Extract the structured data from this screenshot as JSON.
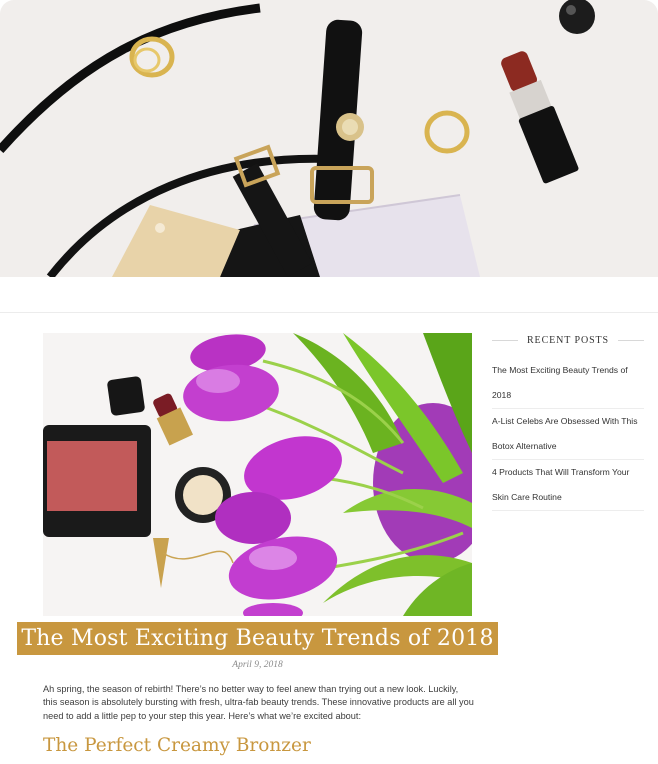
{
  "colors": {
    "accent": "#c8973f",
    "text": "#3d3d3d",
    "divider": "#ececec"
  },
  "sidebar": {
    "widget_title": "RECENT POSTS",
    "posts": [
      {
        "title": "The Most Exciting Beauty Trends of 2018"
      },
      {
        "title": "A-List Celebs Are Obsessed With This Botox Alternative"
      },
      {
        "title": "4 Products That Will Transform Your Skin Care Routine"
      }
    ]
  },
  "post": {
    "title": "The Most Exciting Beauty Trends of 2018",
    "date": "April 9, 2018",
    "excerpt": "Ah spring, the season of rebirth! There’s no better way to feel anew than trying out a new look. Luckily, this season is absolutely bursting with fresh, ultra-fab beauty trends. These innovative products are all you need to add a little pep to your step this year. Here’s what we’re excited about:",
    "subheading": "The Perfect Creamy Bronzer"
  }
}
